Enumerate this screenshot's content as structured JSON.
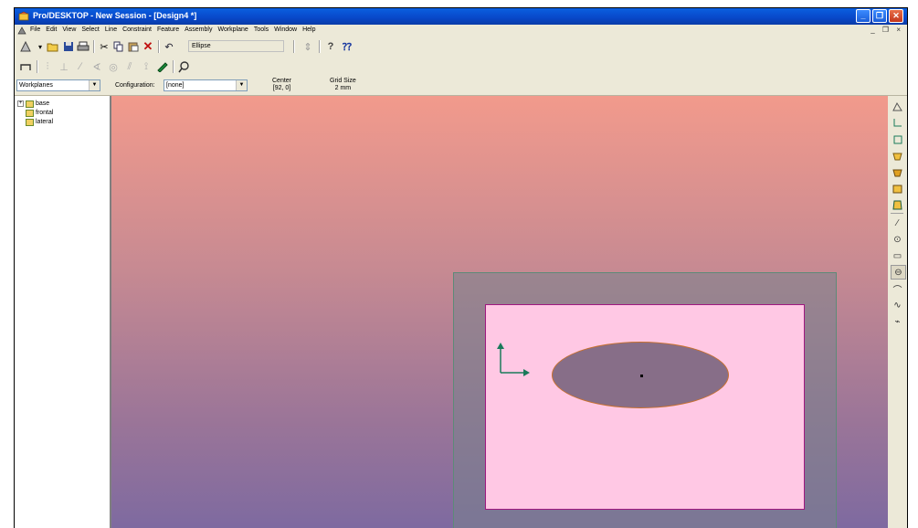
{
  "window": {
    "title": "Pro/DESKTOP - New Session - [Design4 *]",
    "buttons": [
      "_",
      "❐",
      "✕"
    ]
  },
  "menu": {
    "items": [
      "File",
      "Edit",
      "View",
      "Select",
      "Line",
      "Constraint",
      "Feature",
      "Assembly",
      "Workplane",
      "Tools",
      "Window",
      "Help"
    ],
    "mdi_controls": "_ ❐ ×"
  },
  "toolbar": {
    "active_tool": "Ellipse"
  },
  "config_row": {
    "browser_mode": "Workplanes",
    "configuration_label": "Configuration:",
    "configuration_value": "[none]",
    "center_label": "Center",
    "center_value": "[92, 0]",
    "grid_label": "Grid Size",
    "grid_value": "2 mm"
  },
  "tree": {
    "items": [
      "base",
      "frontal",
      "lateral"
    ]
  },
  "colors": {
    "titlebar": "#0a5fe0",
    "sketch_fill": "#ffc8e4",
    "ellipse_fill": "#876e88",
    "axis": "#1a7a5a"
  }
}
